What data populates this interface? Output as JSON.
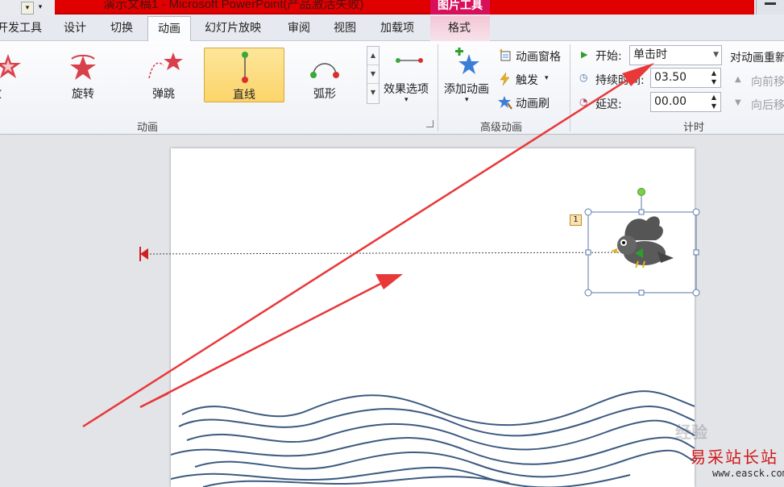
{
  "window": {
    "title": "演示文稿1 - Microsoft PowerPoint(产品激活失败)",
    "context_tab": "图片工具"
  },
  "tabs": [
    {
      "label": "开发工具"
    },
    {
      "label": "设计"
    },
    {
      "label": "切换"
    },
    {
      "label": "动画",
      "active": true
    },
    {
      "label": "幻灯片放映"
    },
    {
      "label": "审阅"
    },
    {
      "label": "视图"
    },
    {
      "label": "加载项"
    },
    {
      "label": "格式"
    }
  ],
  "animation_gallery": {
    "items": [
      {
        "label": "缩放",
        "icon": "zoom-star-icon"
      },
      {
        "label": "旋转",
        "icon": "spin-star-icon"
      },
      {
        "label": "弹跳",
        "icon": "bounce-star-icon"
      },
      {
        "label": "直线",
        "icon": "line-path-icon",
        "selected": true
      },
      {
        "label": "弧形",
        "icon": "arc-path-icon"
      }
    ],
    "effect_options_label": "效果选项",
    "group_label": "动画"
  },
  "advanced_animation": {
    "add_animation_label": "添加动画",
    "animation_pane_label": "动画窗格",
    "trigger_label": "触发",
    "animation_painter_label": "动画刷",
    "group_label": "高级动画"
  },
  "timing": {
    "start_label": "开始:",
    "start_value": "单击时",
    "duration_label": "持续时间:",
    "duration_value": "03.50",
    "delay_label": "延迟:",
    "delay_value": "00.00",
    "reorder_label": "对动画重新排序",
    "move_earlier_label": "向前移动",
    "move_later_label": "向后移动",
    "group_label": "计时"
  },
  "slide": {
    "animation_order_tag": "1"
  },
  "watermark": {
    "main": "易采站长站",
    "url": "www.easck.com",
    "faint": "经验"
  },
  "colors": {
    "title_red": "#e00000",
    "context_pink": "#d8105c",
    "annotation_arrow": "#e8383a",
    "wave_blue": "#3c5a80",
    "gallery_selected": "#fcd46a"
  }
}
